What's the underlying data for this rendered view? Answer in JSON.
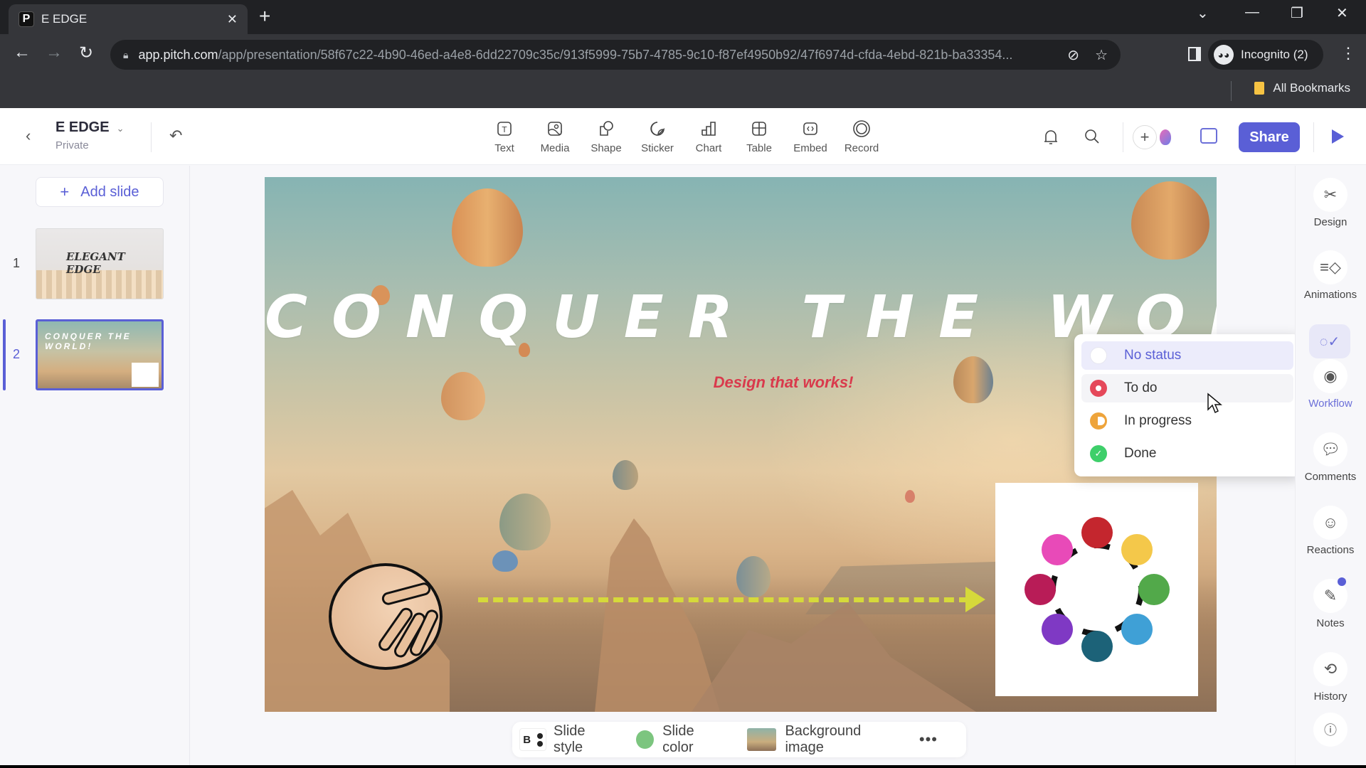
{
  "browser": {
    "tab_title": "E EDGE",
    "tab_favicon": "P",
    "url_host": "app.pitch.com",
    "url_path": "/app/presentation/58f67c22-4b90-46ed-a4e8-6dd22709c35c/913f5999-75b7-4785-9c10-f87ef4950b92/47f6974d-cfda-4ebd-821b-ba33354...",
    "profile_label": "Incognito (2)",
    "bookmarks_label": "All Bookmarks"
  },
  "header": {
    "doc_title": "E EDGE",
    "doc_visibility": "Private",
    "tools": [
      {
        "label": "Text",
        "icon": "text-icon"
      },
      {
        "label": "Media",
        "icon": "media-icon"
      },
      {
        "label": "Shape",
        "icon": "shape-icon"
      },
      {
        "label": "Sticker",
        "icon": "sticker-icon"
      },
      {
        "label": "Chart",
        "icon": "chart-icon"
      },
      {
        "label": "Table",
        "icon": "table-icon"
      },
      {
        "label": "Embed",
        "icon": "embed-icon"
      },
      {
        "label": "Record",
        "icon": "record-icon"
      }
    ],
    "share_label": "Share",
    "accent_color": "#5a5fd6"
  },
  "sidebar": {
    "add_slide_label": "Add slide",
    "slides": [
      {
        "number": "1",
        "thumb_title": "ELEGANT EDGE"
      },
      {
        "number": "2",
        "thumb_title": "CONQUER THE WORLD!",
        "selected": true
      }
    ]
  },
  "slide": {
    "headline": "CONQUER THE WORLD!",
    "subheadline": "Design that works!"
  },
  "status_menu": {
    "items": [
      {
        "label": "No status",
        "color": "#ffffff",
        "selected": true
      },
      {
        "label": "To do",
        "color": "#e5485a",
        "hovered": true
      },
      {
        "label": "In progress",
        "color": "#eea43b"
      },
      {
        "label": "Done",
        "color": "#3ecf6a"
      }
    ]
  },
  "right_rail": {
    "items": [
      {
        "label": "Design",
        "icon": "design-icon"
      },
      {
        "label": "Animations",
        "icon": "animations-icon"
      },
      {
        "label": "Workflow",
        "icon": "workflow-icon"
      },
      {
        "label": "Comments",
        "icon": "comments-icon"
      },
      {
        "label": "Reactions",
        "icon": "reactions-icon"
      },
      {
        "label": "Notes",
        "icon": "notes-icon"
      },
      {
        "label": "History",
        "icon": "history-icon"
      }
    ],
    "help_icon": "help-icon"
  },
  "bottom_bar": {
    "slide_style_label": "Slide style",
    "slide_style_letter": "B",
    "slide_color_label": "Slide color",
    "slide_color": "#7cc57f",
    "background_image_label": "Background image",
    "more_label": "•••"
  }
}
